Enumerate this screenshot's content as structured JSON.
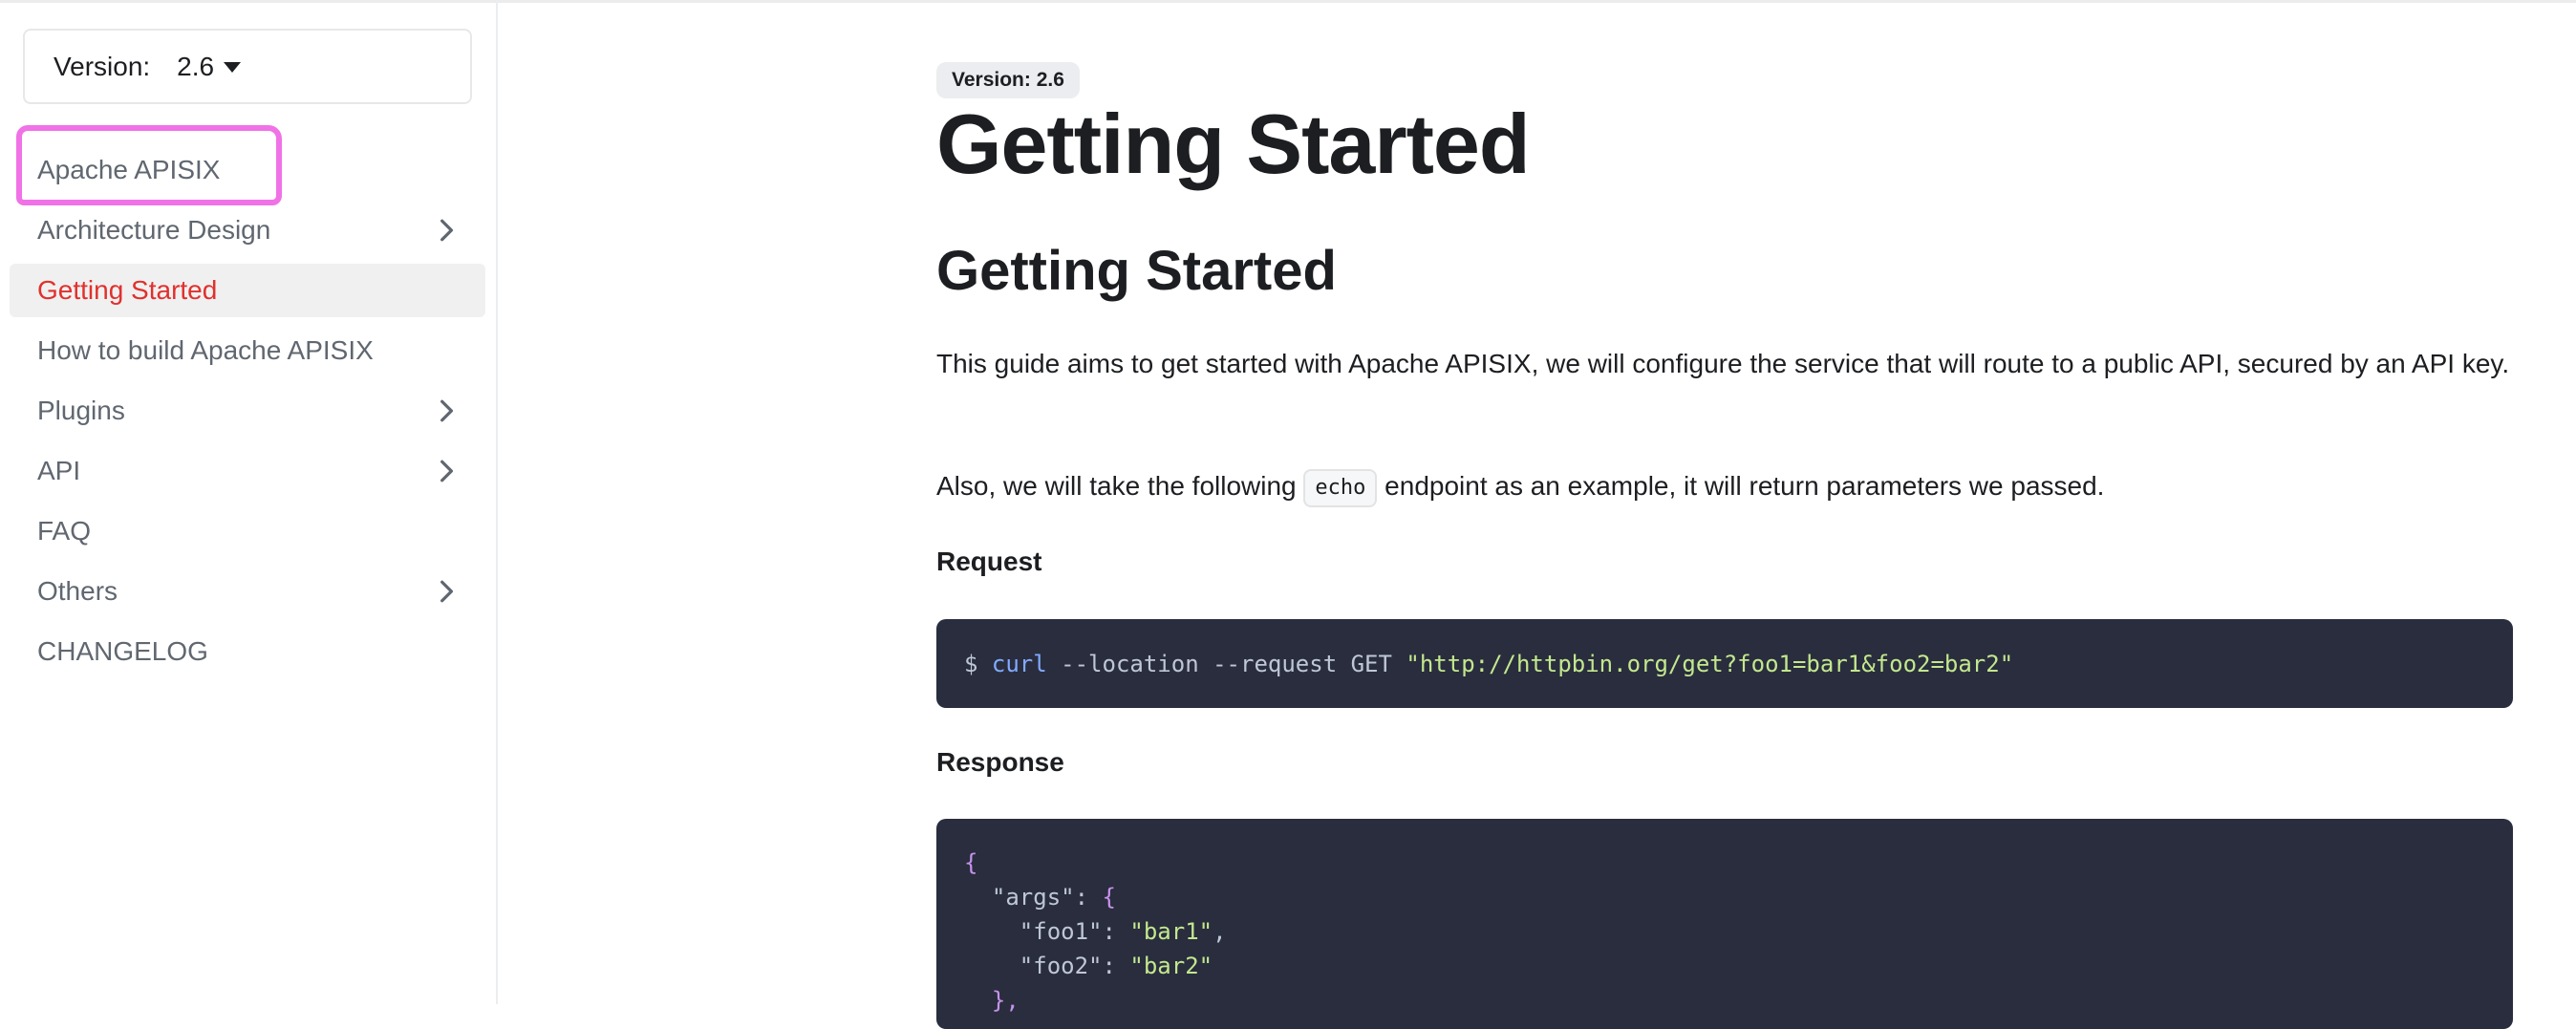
{
  "sidebar": {
    "version_label": "Version:",
    "version_value": "2.6",
    "items": [
      {
        "label": "Apache APISIX",
        "expandable": false,
        "active": false
      },
      {
        "label": "Architecture Design",
        "expandable": true,
        "active": false
      },
      {
        "label": "Getting Started",
        "expandable": false,
        "active": true
      },
      {
        "label": "How to build Apache APISIX",
        "expandable": false,
        "active": false
      },
      {
        "label": "Plugins",
        "expandable": true,
        "active": false
      },
      {
        "label": "API",
        "expandable": true,
        "active": false
      },
      {
        "label": "FAQ",
        "expandable": false,
        "active": false
      },
      {
        "label": "Others",
        "expandable": true,
        "active": false
      },
      {
        "label": "CHANGELOG",
        "expandable": false,
        "active": false
      }
    ]
  },
  "main": {
    "badge": "Version: 2.6",
    "title": "Getting Started",
    "heading": "Getting Started",
    "para1": "This guide aims to get started with Apache APISIX, we will configure the service that will route to a public API, secured by an API key.",
    "para2_before": "Also, we will take the following",
    "para2_code": "echo",
    "para2_after": "endpoint as an example, it will return parameters we passed.",
    "request_heading": "Request",
    "request_code": {
      "prompt": "$",
      "cmd": "curl",
      "args": "--location --request GET",
      "url": "\"http://httpbin.org/get?foo1=bar1&foo2=bar2\""
    },
    "response_heading": "Response",
    "response_lines": {
      "l1": "{",
      "l2_key": "  \"args\": ",
      "l2_brace": "{",
      "l3_key": "    \"foo1\": ",
      "l3_val": "\"bar1\"",
      "l3_comma": ",",
      "l4_key": "    \"foo2\": ",
      "l4_val": "\"bar2\"",
      "l5": "  },"
    }
  },
  "colors": {
    "accent_active": "#e0312d",
    "annotation": "#f072e6",
    "code_bg": "#292d3e"
  }
}
